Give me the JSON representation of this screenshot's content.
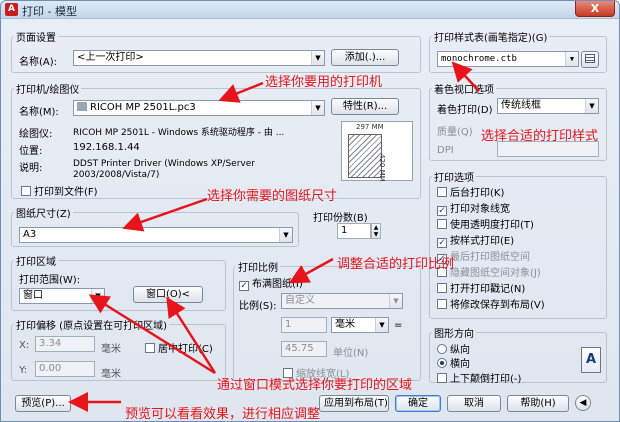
{
  "window": {
    "title": "打印 - 模型",
    "close": "X",
    "app_icon": "A"
  },
  "page_setup": {
    "legend": "页面设置",
    "name_label": "名称(A):",
    "name_value": "<上一次打印>",
    "add_button": "添加(.)..."
  },
  "printer": {
    "legend": "打印机/绘图仪",
    "name_label": "名称(M):",
    "name_value": "RICOH MP 2501L.pc3",
    "properties_button": "特性(R)...",
    "plotter_label": "绘图仪:",
    "plotter_value": "RICOH MP 2501L - Windows 系统驱动程序 - 由 ...",
    "location_label": "位置:",
    "location_value": "192.168.1.44",
    "description_label": "说明:",
    "description_line1": "DDST Printer Driver (Windows XP/Server",
    "description_line2": "2003/2008/Vista/7)",
    "print_to_file": "打印到文件(F)",
    "preview_width": "297 MM",
    "preview_height": "420 MM"
  },
  "paper_size": {
    "legend": "图纸尺寸(Z)",
    "value": "A3"
  },
  "copies": {
    "label": "打印份数(B)",
    "value": "1"
  },
  "plot_area": {
    "legend": "打印区域",
    "range_label": "打印范围(W):",
    "range_value": "窗口",
    "window_button": "窗口(O)<"
  },
  "plot_offset": {
    "legend": "打印偏移 (原点设置在可打印区域)",
    "x_label": "X:",
    "x_value": "3.34",
    "x_unit": "毫米",
    "y_label": "Y:",
    "y_value": "0.00",
    "y_unit": "毫米",
    "center_plot": "居中打印(C)"
  },
  "plot_scale": {
    "legend": "打印比例",
    "fit_paper": "布满图纸(I)",
    "scale_label": "比例(S):",
    "scale_value": "自定义",
    "value1": "1",
    "unit_value": "毫米",
    "equals": "=",
    "value2": "45.75",
    "unit_label": "单位(N)",
    "scale_lineweights": "缩放线宽(L)"
  },
  "plot_style_table": {
    "legend": "打印样式表(画笔指定)(G)",
    "value": "monochrome.ctb"
  },
  "shaded_viewport": {
    "legend": "着色视口选项",
    "shade_label": "着色打印(D)",
    "shade_value": "传统线框",
    "quality_label": "质量(Q)",
    "dpi_label": "DPI"
  },
  "plot_options": {
    "legend": "打印选项",
    "items": [
      {
        "label": "后台打印(K)",
        "checked": false,
        "disabled": false
      },
      {
        "label": "打印对象线宽",
        "checked": true,
        "disabled": false
      },
      {
        "label": "使用透明度打印(T)",
        "checked": false,
        "disabled": false
      },
      {
        "label": "按样式打印(E)",
        "checked": true,
        "disabled": false
      },
      {
        "label": "最后打印图纸空间",
        "checked": true,
        "disabled": true
      },
      {
        "label": "隐藏图纸空间对象(J)",
        "checked": false,
        "disabled": true
      },
      {
        "label": "打开打印戳记(N)",
        "checked": false,
        "disabled": false
      },
      {
        "label": "将修改保存到布局(V)",
        "checked": false,
        "disabled": false
      }
    ]
  },
  "orientation": {
    "legend": "图形方向",
    "portrait": "纵向",
    "landscape": "横向",
    "upside_down": "上下颠倒打印(-)"
  },
  "buttons": {
    "preview": "预览(P)...",
    "apply_layout": "应用到布局(T)",
    "ok": "确定",
    "cancel": "取消",
    "help": "帮助(H)"
  },
  "annotations": {
    "printer": "选择你要用的打印机",
    "style": "选择合适的打印样式",
    "paper": "选择你需要的图纸尺寸",
    "scale": "调整合适的打印比例",
    "window": "通过窗口模式选择你要打印的区域",
    "preview": "预览可以看看效果，进行相应调整"
  },
  "colors": {
    "annotation": "#e8141b",
    "title_bg": "#c4d5ea",
    "window_bg": "#e5ebf3"
  }
}
